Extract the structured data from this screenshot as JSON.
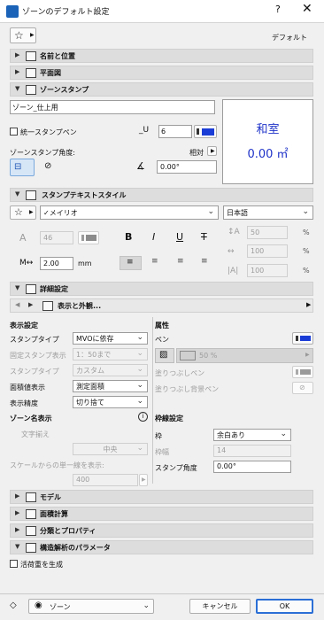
{
  "titlebar": {
    "title": "ゾーンのデフォルト設定",
    "help": "?",
    "close": "✕"
  },
  "toolbar": {
    "favorites_icon": "star-icon",
    "default_label": "デフォルト"
  },
  "sections": {
    "name_position": "名前と位置",
    "floor_plan": "平面図",
    "zone_stamp": "ゾーンスタンプ",
    "stamp_text_style": "スタンプテキストスタイル",
    "details": "詳細設定",
    "model": "モデル",
    "area_calc": "面積計算",
    "classification": "分類とプロパティ",
    "structural": "構造解析のパラメータ"
  },
  "stamp": {
    "name_value": "ゾーン_仕上用",
    "unified_pen_label": "統一スタンプペン",
    "pen_value": "6",
    "angle_label": "ゾーンスタンプ角度:",
    "relative_label": "相対",
    "angle_value": "0.00°",
    "preview_name": "和室",
    "preview_area": "0.00 ㎡"
  },
  "text_style": {
    "font": "✓メイリオ",
    "language": "日本語",
    "size_value": "46",
    "bold": "B",
    "italic": "I",
    "underline": "U",
    "strike": "T",
    "width_value": "2.00",
    "width_unit": "mm",
    "pct1": "50",
    "pct2": "100",
    "pct3": "100",
    "pct_unit": "%"
  },
  "details": {
    "nav_label": "表示と外観...",
    "display_heading": "表示設定",
    "rows": [
      {
        "label": "スタンプタイプ",
        "value": "MVOに依存",
        "enabled": true
      },
      {
        "label": "固定スタンプ表示",
        "value": "1：50まで",
        "enabled": false
      },
      {
        "label": "スタンプタイプ",
        "value": "カスタム",
        "enabled": false
      },
      {
        "label": "面積値表示",
        "value": "測定面積",
        "enabled": true
      },
      {
        "label": "表示精度",
        "value": "切り捨て",
        "enabled": true
      }
    ],
    "zone_name_heading": "ゾーン名表示",
    "align_label": "文字揃え",
    "align_value": "中央",
    "scale_label": "スケールからの単一線を表示:",
    "scale_value": "400",
    "attr_heading": "属性",
    "pen_label": "ペン",
    "fill_pct": "50 %",
    "fill_pen_label": "塗りつぶしペン",
    "fill_bg_label": "塗りつぶし背景ペン",
    "frame_heading": "枠線設定",
    "frame_label": "枠",
    "frame_value": "余白あり",
    "frame_width_label": "枠幅",
    "frame_width_value": "14",
    "stamp_angle_label": "スタンプ角度",
    "stamp_angle_value": "0.00°"
  },
  "load": {
    "generate_label": "活荷重を生成"
  },
  "footer": {
    "layer_label": "ゾーン",
    "cancel": "キャンセル",
    "ok": "OK"
  },
  "colors": {
    "accent": "#1a3cd6",
    "preview_text": "#1e32c8"
  }
}
